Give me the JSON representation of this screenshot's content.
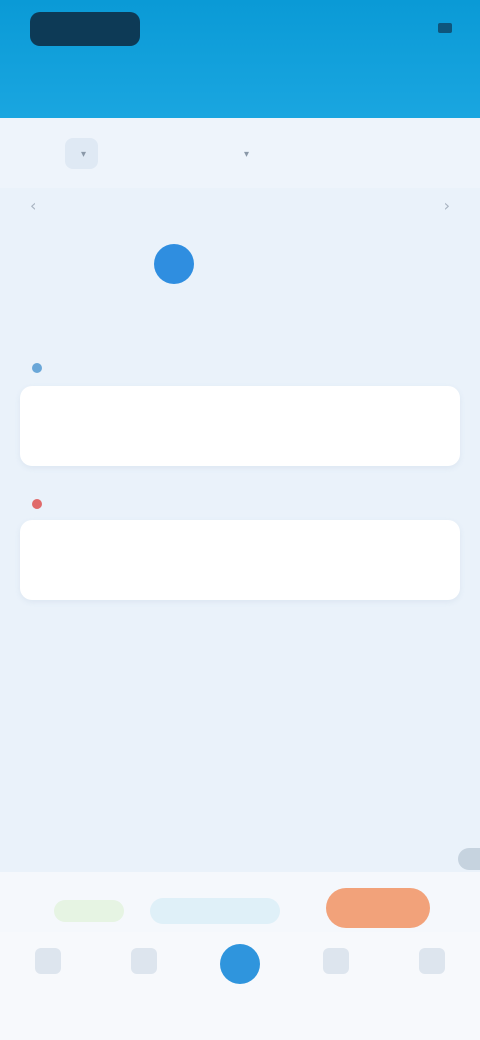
{
  "status": {
    "time": "",
    "right": ""
  },
  "header": {
    "title": ""
  },
  "tabs": [
    {
      "label": "",
      "active": true
    },
    {
      "label": "",
      "active": false
    },
    {
      "label": "",
      "active": false
    }
  ],
  "calendar": {
    "month": "",
    "days": [
      {
        "dow": "",
        "date": ""
      },
      {
        "dow": "",
        "date": ""
      },
      {
        "dow": "",
        "date": "",
        "selected": true
      },
      {
        "dow": "",
        "date": ""
      },
      {
        "dow": "",
        "date": ""
      },
      {
        "dow": "",
        "date": ""
      },
      {
        "dow": "",
        "date": ""
      }
    ]
  },
  "cards": [
    {
      "label": "",
      "content": "",
      "accent": "#6aa7d8"
    },
    {
      "label": "",
      "content": "",
      "accent": "#e06a6a"
    }
  ],
  "actions": {
    "green": "",
    "blue": "",
    "orange": ""
  },
  "tabbar": [
    {
      "label": "",
      "icon": "home-icon"
    },
    {
      "label": "",
      "icon": "list-icon"
    },
    {
      "label": "",
      "icon": "add-icon"
    },
    {
      "label": "",
      "icon": "chart-icon"
    },
    {
      "label": "",
      "icon": "profile-icon"
    }
  ],
  "colors": {
    "primary": "#0a9ad6",
    "accent": "#2f8ee0",
    "cta": "#f2a27a"
  }
}
